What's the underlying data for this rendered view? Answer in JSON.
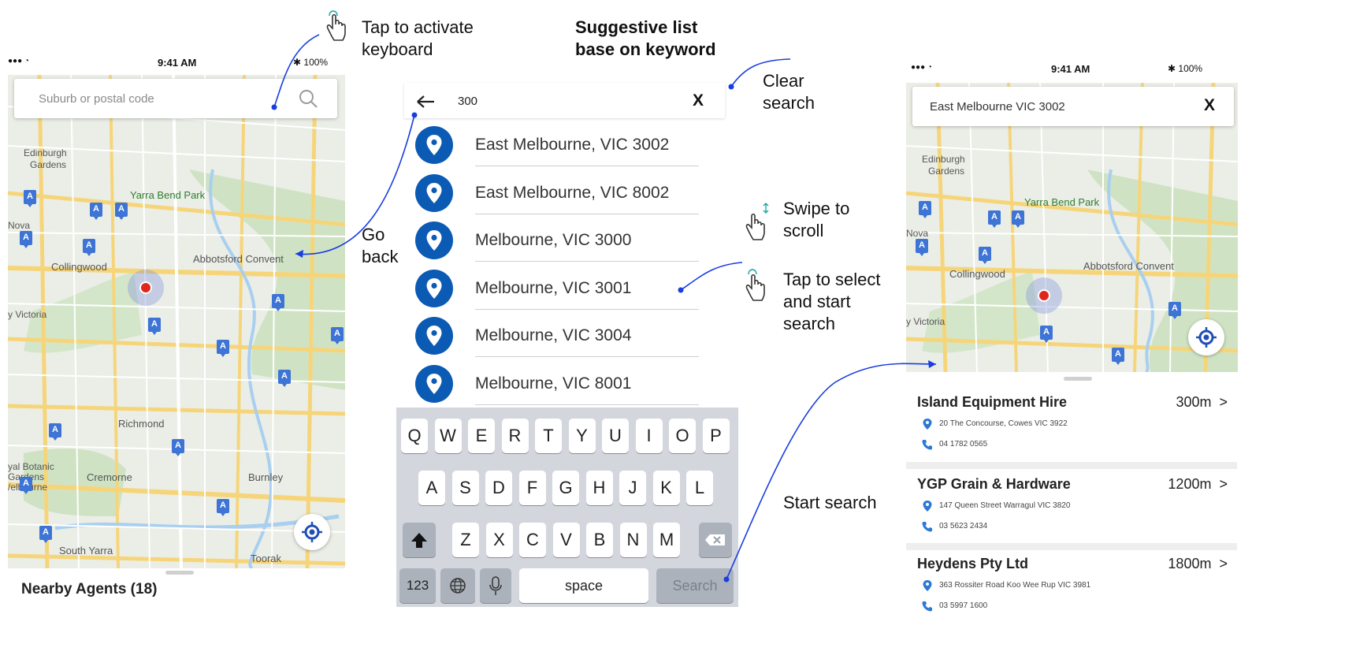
{
  "left_phone": {
    "status": {
      "signal": "●●● ◔",
      "time": "9:41 AM",
      "battery": "✱ 100%"
    },
    "search_placeholder": "Suburb or postal code",
    "map_labels": [
      "Edinburgh Gardens",
      "Yarra Bend Park",
      "Nova",
      "Collingwood",
      "Abbotsford Convent",
      "y Victoria",
      "Richmond",
      "yal Botanic Gardens /elbourne",
      "Cremorne",
      "Burnley",
      "South Yarra",
      "Toorak"
    ],
    "nearby_title": "Nearby Agents (18)"
  },
  "middle_phone": {
    "search_value": "300",
    "clear_label": "X",
    "suggestions": [
      "East Melbourne, VIC 3002",
      "East Melbourne, VIC 8002",
      "Melbourne, VIC 3000",
      "Melbourne, VIC 3001",
      "Melbourne, VIC 3004",
      "Melbourne, VIC 8001"
    ],
    "keyboard": {
      "row1": [
        "Q",
        "W",
        "E",
        "R",
        "T",
        "Y",
        "U",
        "I",
        "O",
        "P"
      ],
      "row2": [
        "A",
        "S",
        "D",
        "F",
        "G",
        "H",
        "J",
        "K",
        "L"
      ],
      "row3": [
        "Z",
        "X",
        "C",
        "V",
        "B",
        "N",
        "M"
      ],
      "numbers": "123",
      "space": "space",
      "search": "Search"
    }
  },
  "right_phone": {
    "status": {
      "signal": "●●● ◔",
      "time": "9:41 AM",
      "battery": "✱ 100%"
    },
    "search_value": "East Melbourne VIC 3002",
    "clear_label": "X",
    "results": [
      {
        "name": "Island Equipment Hire",
        "distance": "300m",
        "address": "20 The Concourse, Cowes VIC 3922",
        "phone": "04 1782 0565"
      },
      {
        "name": "YGP Grain & Hardware",
        "distance": "1200m",
        "address": "147 Queen Street Warragul VIC 3820",
        "phone": "03 5623 2434"
      },
      {
        "name": "Heydens Pty Ltd",
        "distance": "1800m",
        "address": "363 Rossiter Road Koo Wee Rup VIC 3981",
        "phone": "03 5997 1600"
      }
    ]
  },
  "annotations": {
    "tap_keyboard": "Tap to activate keyboard",
    "suggestive": "Suggestive list base on keyword",
    "clear": "Clear search",
    "go_back": "Go back",
    "swipe": "Swipe to scroll",
    "tap_select": "Tap to select and start search",
    "start_search": "Start search"
  },
  "colors": {
    "pin_blue": "#0b5ab4",
    "annotation_line": "#1a3de0",
    "agent_pin": "#3d74d6",
    "user_dot": "#e0261c"
  }
}
